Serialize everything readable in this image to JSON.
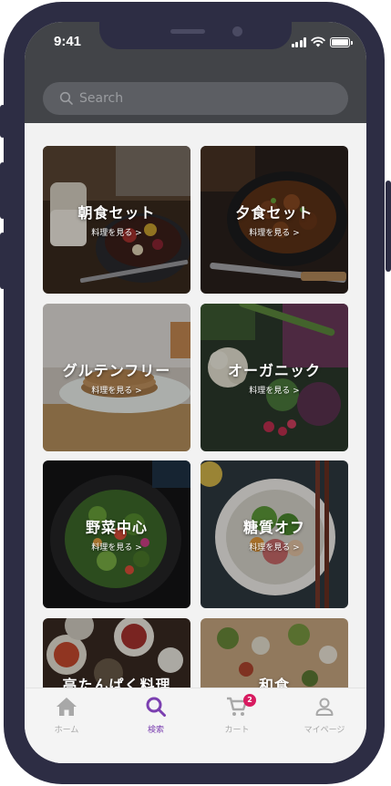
{
  "status_bar": {
    "time": "9:41"
  },
  "search": {
    "placeholder": "Search"
  },
  "categories": [
    {
      "title": "朝食セット",
      "link": "料理を見る >"
    },
    {
      "title": "夕食セット",
      "link": "料理を見る >"
    },
    {
      "title": "グルテンフリー",
      "link": "料理を見る >"
    },
    {
      "title": "オーガニック",
      "link": "料理を見る >"
    },
    {
      "title": "野菜中心",
      "link": "料理を見る >"
    },
    {
      "title": "糖質オフ",
      "link": "料理を見る >"
    },
    {
      "title": "高たんぱく料理",
      "link": ""
    },
    {
      "title": "和食",
      "link": ""
    }
  ],
  "tabbar": {
    "items": [
      {
        "label": "ホーム",
        "icon": "home-icon"
      },
      {
        "label": "検索",
        "icon": "search-icon"
      },
      {
        "label": "カート",
        "icon": "cart-icon"
      },
      {
        "label": "マイページ",
        "icon": "user-icon"
      }
    ],
    "cart_badge": "2",
    "active_color": "#7b3fb0",
    "inactive_color": "#a8a8a8",
    "badge_color": "#d81b60"
  }
}
